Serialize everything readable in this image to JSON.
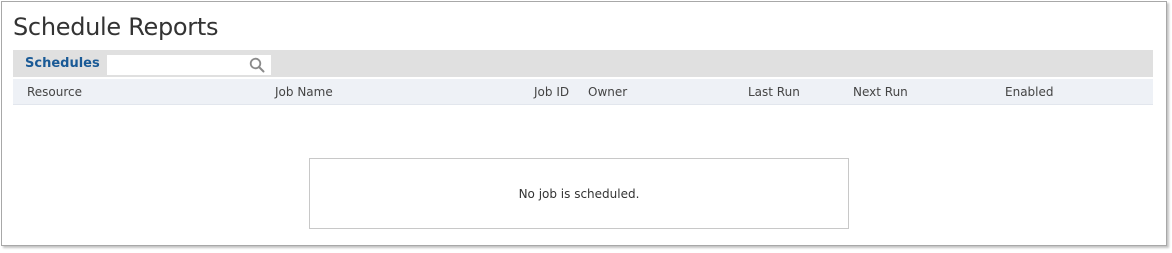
{
  "page": {
    "title": "Schedule Reports"
  },
  "toolbar": {
    "label": "Schedules",
    "search": {
      "value": "",
      "placeholder": "",
      "icon": "search-icon"
    }
  },
  "table": {
    "columns": [
      "Resource",
      "Job Name",
      "Job ID",
      "Owner",
      "Last Run",
      "Next Run",
      "Enabled"
    ],
    "rows": []
  },
  "empty_state": {
    "message": "No job is scheduled."
  },
  "colors": {
    "accent": "#1a5a96",
    "toolbar_bg": "#e0e0e0",
    "header_bg": "#eef1f6"
  }
}
